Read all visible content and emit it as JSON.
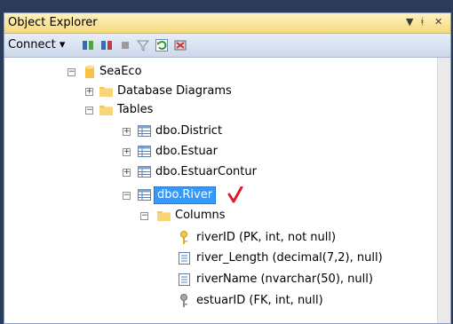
{
  "window": {
    "title": "Object Explorer",
    "pin_glyph": "▾ ꟼ ✕"
  },
  "toolbar": {
    "connect_label": "Connect ▾"
  },
  "tree": {
    "server": "SeaEco",
    "database_diagrams": "Database Diagrams",
    "tables": "Tables",
    "table_district": "dbo.District",
    "table_estuar": "dbo.Estuar",
    "table_estuarcontur": "dbo.EstuarContur",
    "table_river": "dbo.River",
    "columns": "Columns",
    "col_riverid": "riverID (PK, int, not null)",
    "col_river_length": "river_Length (decimal(7,2), null)",
    "col_rivername": "riverName (nvarchar(50), null)",
    "col_estuarid": "estuarID (FK, int, null)"
  },
  "colors": {
    "selection": "#3399ff",
    "folder": "#f3c84f",
    "checkmark": "#e0192d"
  }
}
